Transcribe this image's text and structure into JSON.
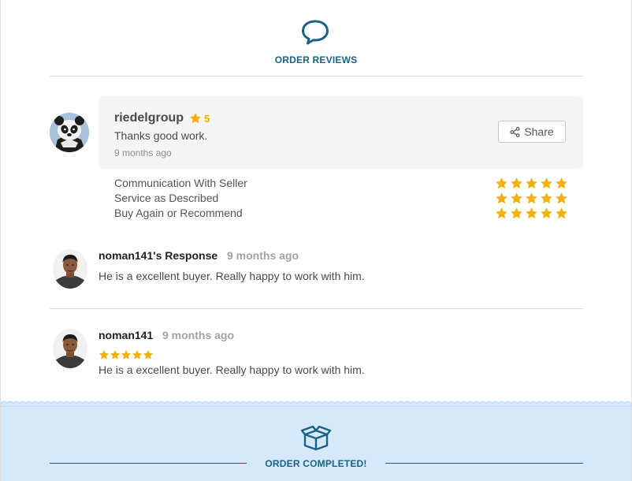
{
  "header": {
    "icon": "speech-bubble-icon",
    "title": "ORDER REVIEWS"
  },
  "review": {
    "username": "riedelgroup",
    "rating": "5",
    "rating_value": 5,
    "text": "Thanks good work.",
    "time": "9 months ago",
    "share_label": "Share",
    "avatar_icon": "panda-avatar"
  },
  "criteria": [
    {
      "label": "Communication With Seller",
      "stars": 5
    },
    {
      "label": "Service as Described",
      "stars": 5
    },
    {
      "label": "Buy Again or Recommend",
      "stars": 5
    }
  ],
  "seller_response": {
    "name": "noman141's Response",
    "time": "9 months ago",
    "text": "He is a excellent buyer. Really happy to work with him."
  },
  "seller_review": {
    "name": "noman141",
    "time": "9 months ago",
    "stars": 5,
    "text": "He is a excellent buyer. Really happy to work with him."
  },
  "footer": {
    "icon": "open-box-icon",
    "title": "ORDER COMPLETED!"
  },
  "colors": {
    "accent": "#1b6385",
    "star": "#f2b10b",
    "footer_bg": "#d6e9fb"
  }
}
